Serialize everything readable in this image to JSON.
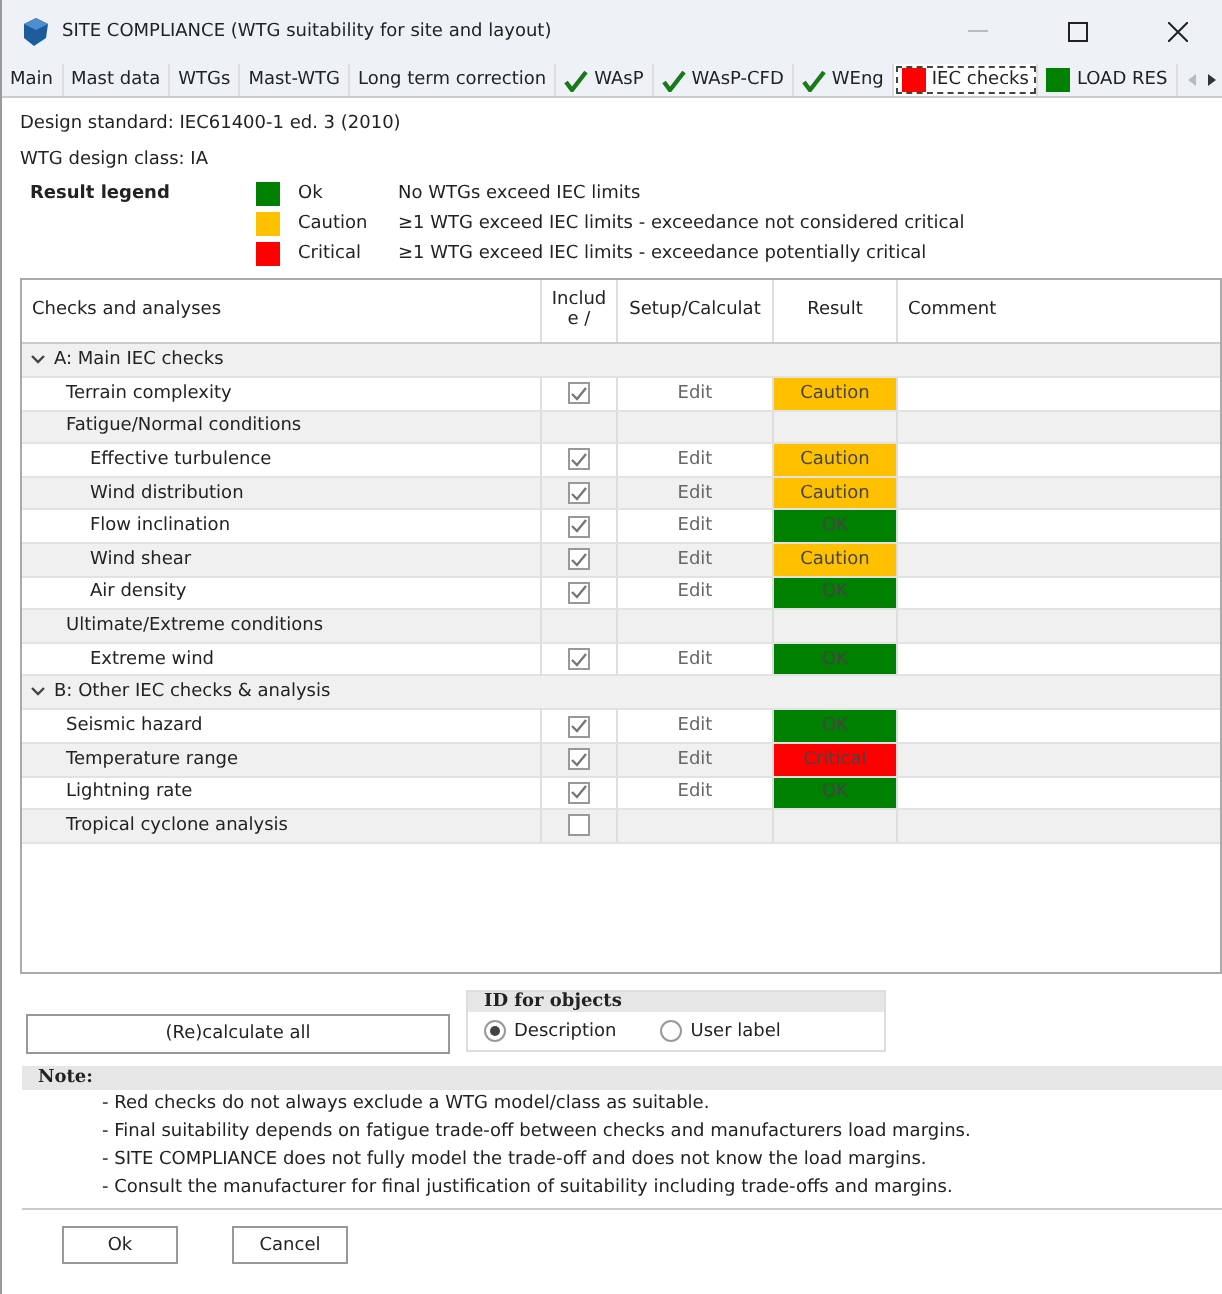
{
  "window": {
    "title": "SITE COMPLIANCE (WTG suitability for site and layout)"
  },
  "tabs": [
    {
      "label": "Main",
      "selected": false,
      "kind": "plain"
    },
    {
      "label": "Mast data",
      "selected": false,
      "kind": "plain"
    },
    {
      "label": "WTGs",
      "selected": false,
      "kind": "plain"
    },
    {
      "label": "Mast-WTG",
      "selected": false,
      "kind": "plain"
    },
    {
      "label": "Long term correction",
      "selected": false,
      "kind": "plain"
    },
    {
      "label": "WAsP",
      "selected": false,
      "kind": "check"
    },
    {
      "label": "WAsP-CFD",
      "selected": false,
      "kind": "check"
    },
    {
      "label": "WEng",
      "selected": false,
      "kind": "check"
    },
    {
      "label": "IEC checks",
      "selected": true,
      "kind": "square",
      "color": "#ff0000"
    },
    {
      "label": "LOAD RES",
      "selected": false,
      "kind": "square",
      "color": "#008000"
    }
  ],
  "design_standard": "Design standard: IEC61400-1 ed. 3 (2010)",
  "design_class": "WTG design class: IA",
  "legend": {
    "title": "Result legend",
    "items": [
      {
        "label": "Ok",
        "color": "#008000",
        "description": "No WTGs exceed IEC limits"
      },
      {
        "label": "Caution",
        "color": "#ffc000",
        "description": "≥1 WTG exceed IEC limits - exceedance not considered critical"
      },
      {
        "label": "Critical",
        "color": "#ff0000",
        "description": "≥1 WTG exceed IEC limits - exceedance potentially critical"
      }
    ]
  },
  "table": {
    "columns": [
      "Checks and analyses",
      "Includ e /",
      "Setup/Calculat",
      "Result",
      "Comment"
    ],
    "rows": [
      {
        "kind": "section",
        "label": "A: Main IEC checks",
        "expanded": true,
        "children": [
          {
            "kind": "check",
            "label": "Terrain complexity",
            "checked": true,
            "edit": "Edit",
            "result": {
              "text": "Caution",
              "color": "#ffc000"
            }
          },
          {
            "kind": "group",
            "label": "Fatigue/Normal conditions",
            "children": [
              {
                "kind": "check",
                "label": "Effective turbulence",
                "checked": true,
                "edit": "Edit",
                "result": {
                  "text": "Caution",
                  "color": "#ffc000"
                }
              },
              {
                "kind": "check",
                "label": "Wind distribution",
                "checked": true,
                "edit": "Edit",
                "result": {
                  "text": "Caution",
                  "color": "#ffc000"
                }
              },
              {
                "kind": "check",
                "label": "Flow inclination",
                "checked": true,
                "edit": "Edit",
                "result": {
                  "text": "OK",
                  "color": "#008000"
                }
              },
              {
                "kind": "check",
                "label": "Wind shear",
                "checked": true,
                "edit": "Edit",
                "result": {
                  "text": "Caution",
                  "color": "#ffc000"
                }
              },
              {
                "kind": "check",
                "label": "Air density",
                "checked": true,
                "edit": "Edit",
                "result": {
                  "text": "OK",
                  "color": "#008000"
                }
              }
            ]
          },
          {
            "kind": "group",
            "label": "Ultimate/Extreme conditions",
            "children": [
              {
                "kind": "check",
                "label": "Extreme wind",
                "checked": true,
                "edit": "Edit",
                "result": {
                  "text": "OK",
                  "color": "#008000"
                }
              }
            ]
          }
        ]
      },
      {
        "kind": "section",
        "label": "B: Other IEC checks & analysis",
        "expanded": true,
        "children": [
          {
            "kind": "check",
            "label": "Seismic hazard",
            "checked": true,
            "edit": "Edit",
            "result": {
              "text": "OK",
              "color": "#008000"
            }
          },
          {
            "kind": "check",
            "label": "Temperature range",
            "checked": true,
            "edit": "Edit",
            "result": {
              "text": "Critical",
              "color": "#ff0000"
            }
          },
          {
            "kind": "check",
            "label": "Lightning rate",
            "checked": true,
            "edit": "Edit",
            "result": {
              "text": "OK",
              "color": "#008000"
            }
          },
          {
            "kind": "check",
            "label": "Tropical cyclone analysis",
            "checked": false
          }
        ]
      }
    ]
  },
  "recalculate_button": "(Re)calculate all",
  "id_for_objects": {
    "title": "ID for objects",
    "options": [
      {
        "label": "Description",
        "selected": true
      },
      {
        "label": "User label",
        "selected": false
      }
    ]
  },
  "note": {
    "title": "Note:",
    "lines": [
      "- Red checks do not always exclude a WTG model/class as suitable.",
      "- Final suitability depends on fatigue trade-off between checks and manufacturers load margins.",
      "- SITE COMPLIANCE does not fully model the trade-off and does not know the load margins.",
      "- Consult the manufacturer for final justification of suitability including trade-offs and margins."
    ]
  },
  "buttons": [
    "Ok",
    "Cancel"
  ]
}
